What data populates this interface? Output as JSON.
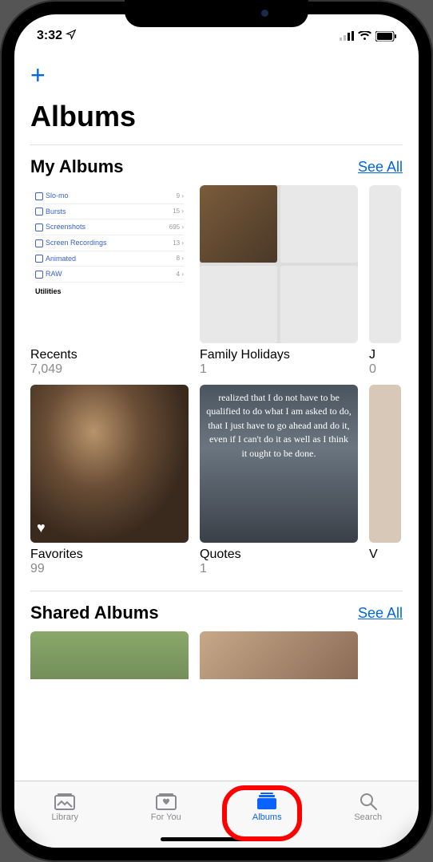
{
  "status": {
    "time": "3:32"
  },
  "header": {
    "add_label": "+",
    "title": "Albums"
  },
  "sections": {
    "my_albums": {
      "title": "My Albums",
      "see_all": "See All",
      "row1": [
        {
          "name": "Recents",
          "count": "7,049"
        },
        {
          "name": "Family Holidays",
          "count": "1"
        },
        {
          "name": "J",
          "count": "0"
        }
      ],
      "row2": [
        {
          "name": "Favorites",
          "count": "99"
        },
        {
          "name": "Quotes",
          "count": "1"
        },
        {
          "name": "V",
          "count": ""
        }
      ]
    },
    "shared": {
      "title": "Shared Albums",
      "see_all": "See All"
    }
  },
  "recents_mini": {
    "rows": [
      {
        "label": "Slo-mo",
        "count": "9"
      },
      {
        "label": "Bursts",
        "count": "15"
      },
      {
        "label": "Screenshots",
        "count": "695"
      },
      {
        "label": "Screen Recordings",
        "count": "13"
      },
      {
        "label": "Animated",
        "count": "8"
      },
      {
        "label": "RAW",
        "count": "4"
      }
    ],
    "utilities": "Utilities"
  },
  "quotes_text": "realized that I do not have to be qualified to do what I am asked to do, that I just have to go ahead and do it, even if I can't do it as well as I think it ought to be done.",
  "tabs": {
    "library": "Library",
    "for_you": "For You",
    "albums": "Albums",
    "search": "Search"
  }
}
